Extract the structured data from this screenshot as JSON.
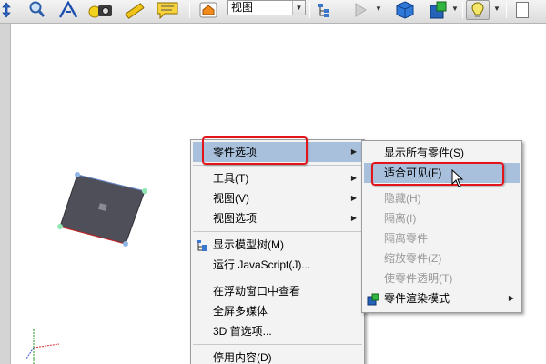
{
  "toolbar": {
    "view_select_value": "视图"
  },
  "context_menu": {
    "items": [
      {
        "label": "零件选项",
        "has_submenu": true,
        "highlighted": true
      },
      {
        "label": "工具(T)",
        "has_submenu": true
      },
      {
        "label": "视图(V)",
        "has_submenu": true
      },
      {
        "label": "视图选项",
        "has_submenu": true
      },
      {
        "label": "显示模型树(M)"
      },
      {
        "label": "运行 JavaScript(J)..."
      },
      {
        "label": "在浮动窗口中查看"
      },
      {
        "label": "全屏多媒体"
      },
      {
        "label": "3D 首选项..."
      },
      {
        "label": "停用内容(D)"
      }
    ]
  },
  "submenu": {
    "items": [
      {
        "label": "显示所有零件(S)",
        "enabled": true
      },
      {
        "label": "适合可见(F)",
        "enabled": true,
        "highlighted": true
      },
      {
        "label": "隐藏(H)",
        "enabled": false
      },
      {
        "label": "隔离(I)",
        "enabled": false
      },
      {
        "label": "隔离零件",
        "enabled": false
      },
      {
        "label": "缩放零件(Z)",
        "enabled": false
      },
      {
        "label": "使零件透明(T)",
        "enabled": false
      },
      {
        "label": "零件渲染模式",
        "enabled": true,
        "has_submenu": true
      }
    ]
  },
  "colors": {
    "highlight": "#a9c0dc",
    "annotation_red": "#e3151a",
    "model_face": "#4f4f5a"
  }
}
